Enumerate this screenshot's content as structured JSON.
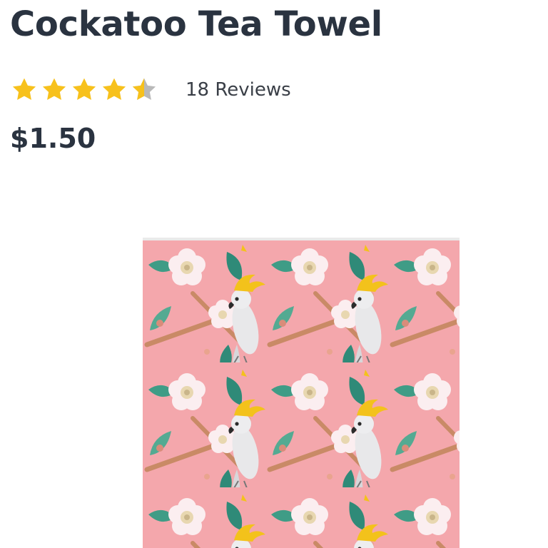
{
  "product": {
    "title": "Cockatoo Tea Towel",
    "rating": 4.5,
    "rating_max": 5,
    "reviews_label": "18 Reviews",
    "price": "$1.50"
  },
  "colors": {
    "title_text": "#2a3340",
    "star_fill": "#f7c11c",
    "star_empty": "#b9b9b9",
    "towel_background": "#f4a7ac",
    "cockatoo_body": "#e8e8ea",
    "cockatoo_crest": "#f3c21b",
    "flower": "#fbeef0",
    "leaf": "#2f8a78",
    "branch": "#c98a66"
  },
  "icons": {
    "star": "star-icon",
    "half_star": "half-star-icon"
  }
}
